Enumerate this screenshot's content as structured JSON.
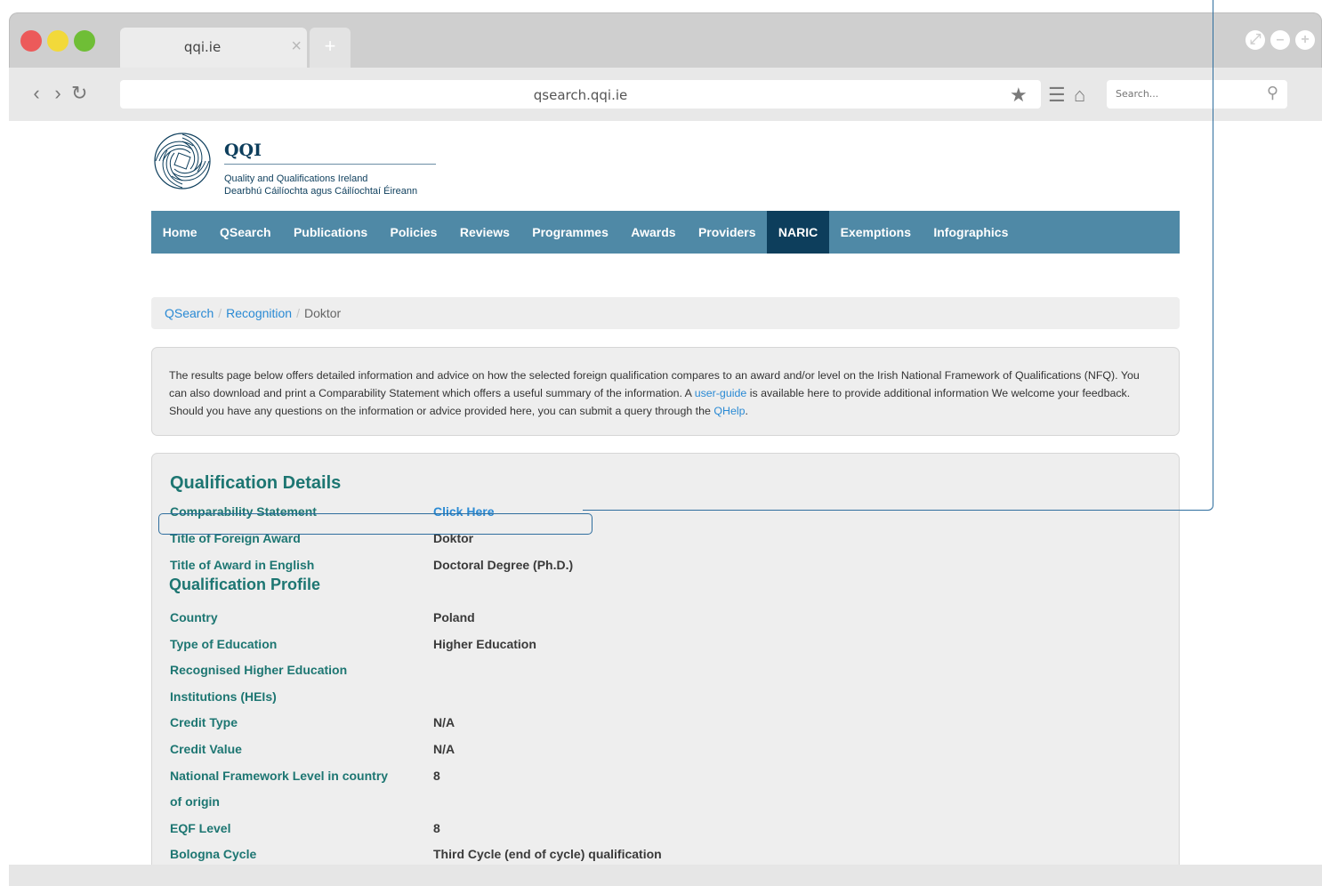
{
  "browser": {
    "tab_title": "qqi.ie",
    "tab_close": "×",
    "new_tab": "+",
    "url": "qsearch.qqi.ie",
    "search_placeholder": "Search...",
    "icons": [
      "back-icon",
      "forward-icon",
      "reload-icon",
      "star-icon",
      "menu-icon",
      "home-icon",
      "search-icon"
    ]
  },
  "logo": {
    "title": "QQI",
    "name_en": "Quality and Qualifications Ireland",
    "name_ga": "Dearbhú Cáilíochta agus Cáilíochtaí Éireann"
  },
  "nav": {
    "items": [
      "Home",
      "QSearch",
      "Publications",
      "Policies",
      "Reviews",
      "Programmes",
      "Awards",
      "Providers",
      "NARIC",
      "Exemptions",
      "Infographics"
    ],
    "active": "NARIC"
  },
  "breadcrumb": {
    "items": [
      "QSearch",
      "Recognition"
    ],
    "current": "Doktor",
    "separator": "/"
  },
  "info": {
    "text_1": "The results page below offers detailed information and advice on how the selected foreign qualification compares to an award and/or level on the Irish National Framework of Qualifications (NFQ). You can also download and print a Comparability Statement which offers a useful summary of the information. A ",
    "link_1": "user-guide",
    "text_2": " is available here to provide additional information We welcome your feedback. Should you have any questions on the information or advice provided here, you can submit a query through the ",
    "link_2": "QHelp",
    "text_3": "."
  },
  "details": {
    "heading": "Qualification Details",
    "rows": [
      {
        "label": "Comparability Statement",
        "value": "Click Here"
      },
      {
        "label": "Title of Foreign Award",
        "value": "Doktor"
      },
      {
        "label": "Title of Award in English",
        "value": "Doctoral Degree (Ph.D.)"
      }
    ],
    "profile_heading": "Qualification Profile",
    "profile_rows": [
      {
        "label": "Country",
        "value": "Poland"
      },
      {
        "label": "Type of Education",
        "value": "Higher Education"
      },
      {
        "label": "Recognised Higher Education",
        "value": ""
      },
      {
        "label": "Institutions (HEIs)",
        "value": ""
      },
      {
        "label": "Credit Type",
        "value": "N/A"
      },
      {
        "label": "Credit Value",
        "value": "N/A"
      },
      {
        "label": "National Framework Level in country",
        "value": "8"
      },
      {
        "label": "of origin",
        "value": ""
      },
      {
        "label": "EQF Level",
        "value": "8"
      },
      {
        "label": "Bologna Cycle",
        "value": "Third Cycle (end of cycle) qualification"
      }
    ]
  },
  "colors": {
    "nav_bg": "#4f89a6",
    "nav_active": "#0d3e5c",
    "label_teal": "#1d7672",
    "link_blue": "#2a8ad4",
    "callout_blue": "#2f6e9e"
  }
}
